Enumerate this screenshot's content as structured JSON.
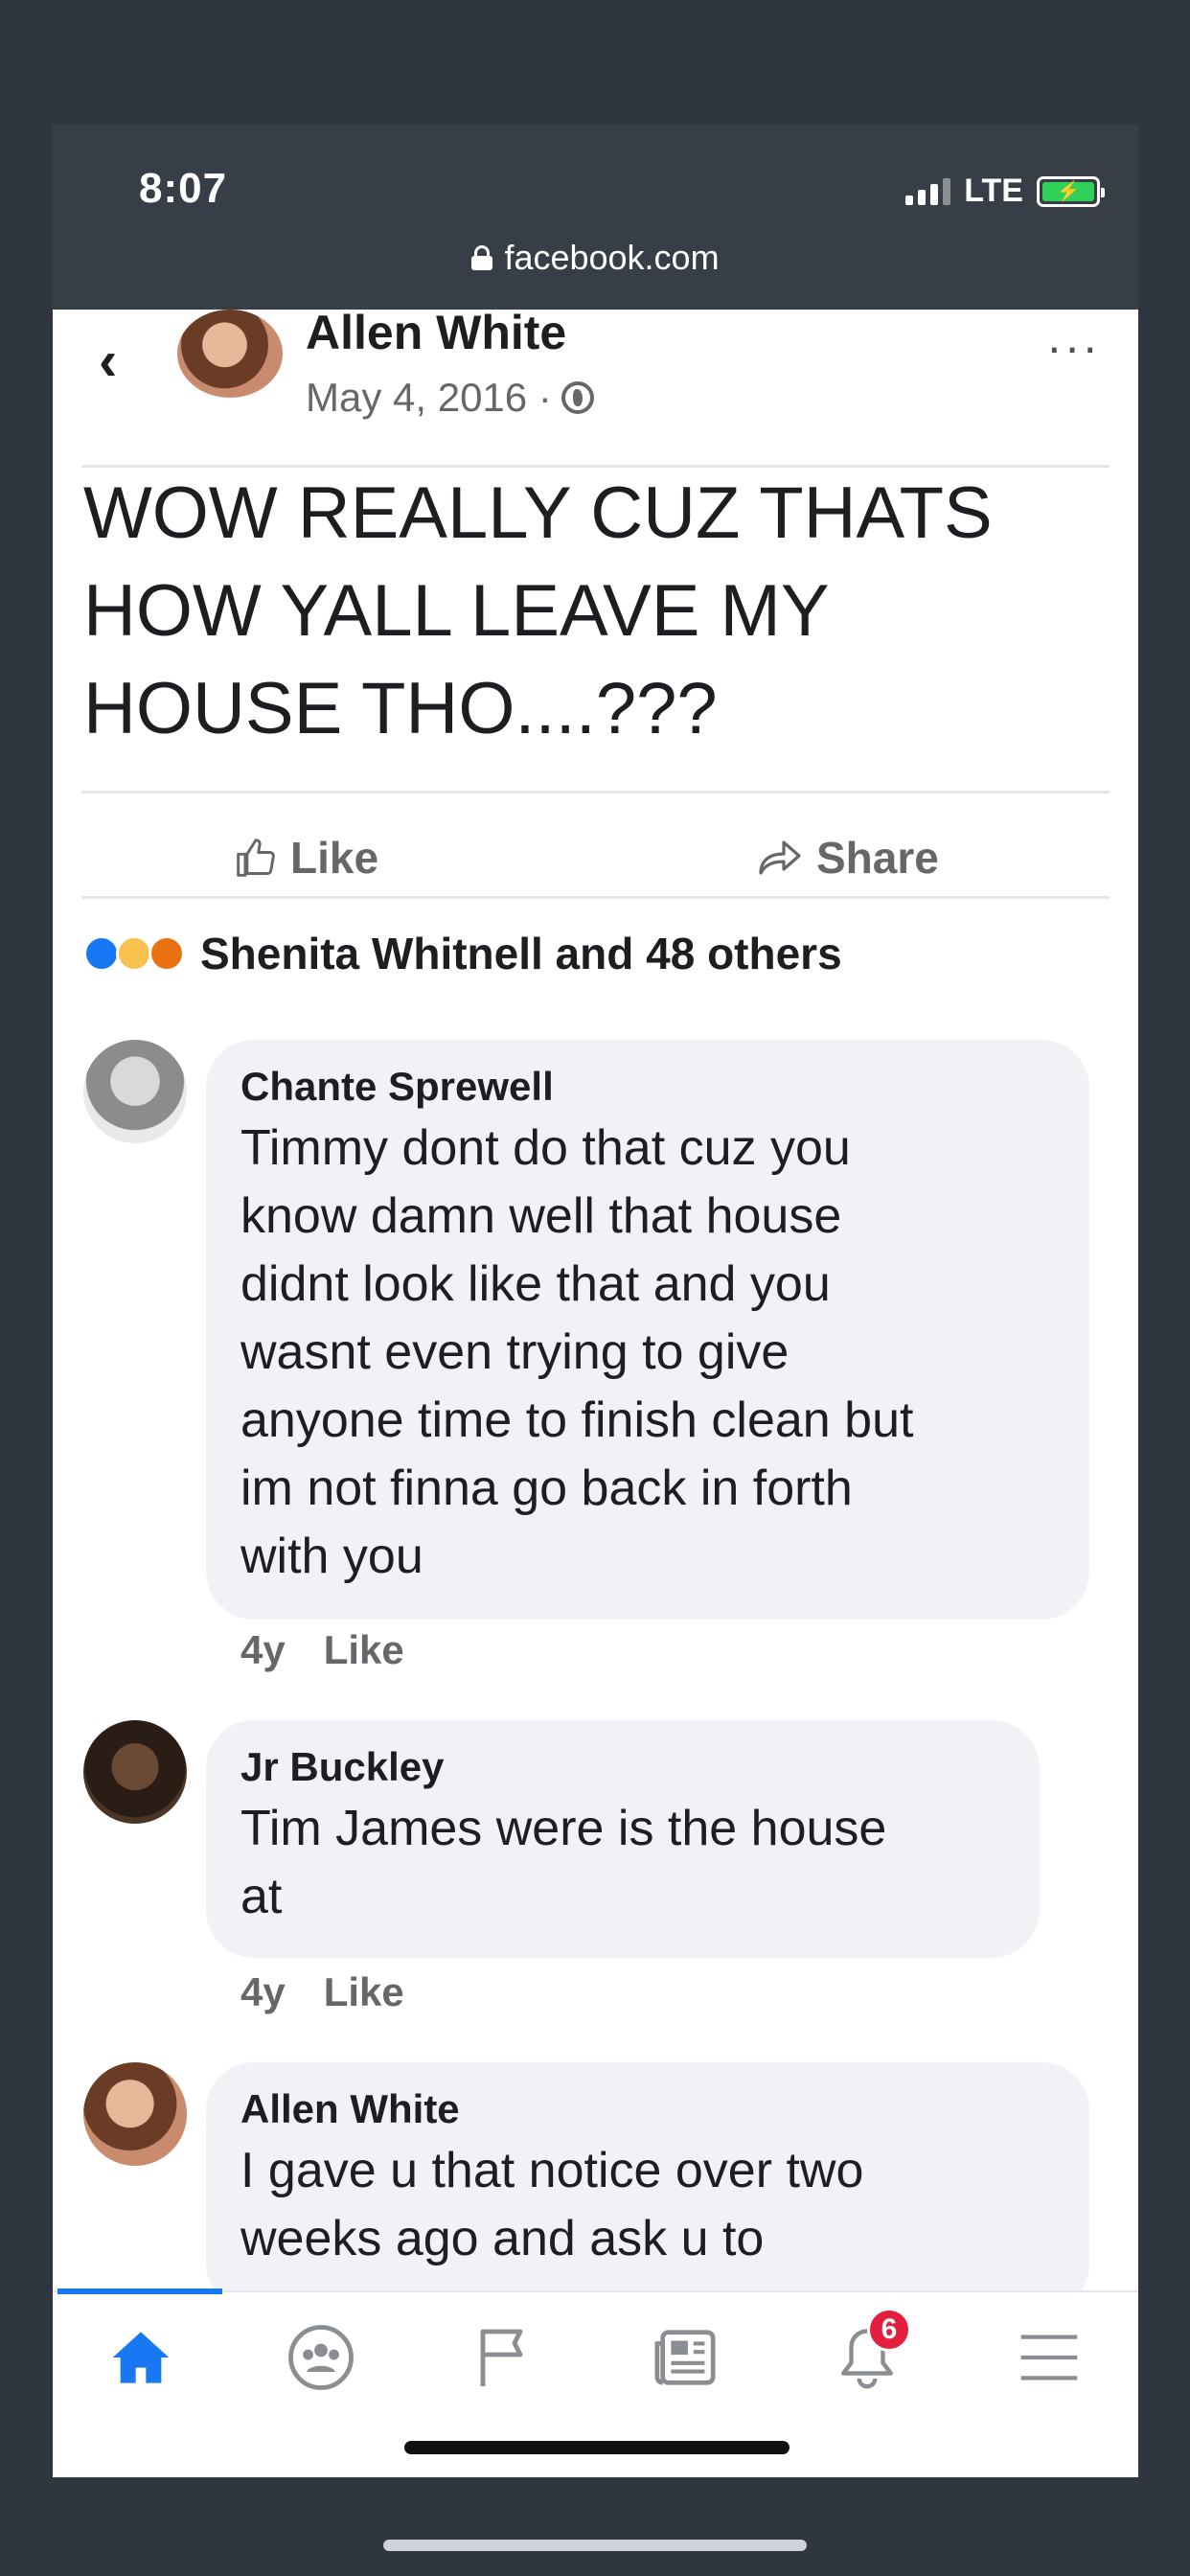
{
  "status_bar": {
    "time": "8:07",
    "network": "LTE",
    "url": "facebook.com"
  },
  "post": {
    "author": "Allen White",
    "date": "May 4, 2016 ·",
    "text_lines": [
      "WOW REALLY CUZ THATS",
      "HOW YALL LEAVE MY",
      "HOUSE THO....???"
    ],
    "like_label": "Like",
    "share_label": "Share",
    "reactions_summary": "Shenita Whitnell and 48 others",
    "reaction_icons": [
      "like-icon",
      "wow-icon",
      "angry-icon"
    ]
  },
  "comments": [
    {
      "name": "Chante Sprewell",
      "lines": [
        "Timmy dont do that cuz you",
        "know damn well that house",
        "didnt look like that and you",
        "wasnt even trying to give",
        "anyone time to finish clean but",
        "im not finna go back in forth",
        "with you"
      ],
      "age": "4y",
      "like": "Like"
    },
    {
      "name": "Jr Buckley",
      "lines": [
        "Tim James were is the house",
        "at"
      ],
      "age": "4y",
      "like": "Like"
    },
    {
      "name": "Allen White",
      "lines": [
        "I gave u that notice over two",
        "weeks ago and ask u to"
      ],
      "age": "",
      "like": ""
    }
  ],
  "tab_bar": {
    "tabs": [
      "home-icon",
      "groups-icon",
      "pages-flag-icon",
      "news-icon",
      "notifications-icon",
      "menu-icon"
    ],
    "notification_badge": "6",
    "active_color": "#1877f2"
  }
}
